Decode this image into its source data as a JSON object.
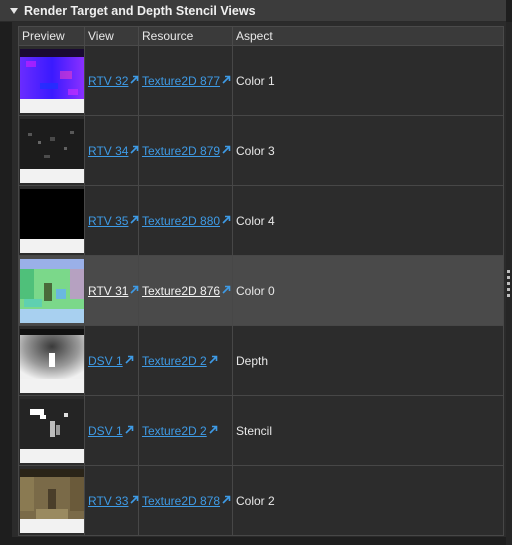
{
  "header": {
    "title": "Render Target and Depth Stencil Views"
  },
  "columns": [
    "Preview",
    "View",
    "Resource",
    "Aspect"
  ],
  "rows": [
    {
      "view": "RTV 32",
      "resource": "Texture2D 877",
      "aspect": "Color 1",
      "selected": false,
      "preview": "blue-purple-noise"
    },
    {
      "view": "RTV 34",
      "resource": "Texture2D 879",
      "aspect": "Color 3",
      "selected": false,
      "preview": "dark-gray-noise"
    },
    {
      "view": "RTV 35",
      "resource": "Texture2D 880",
      "aspect": "Color 4",
      "selected": false,
      "preview": "black"
    },
    {
      "view": "RTV 31",
      "resource": "Texture2D 876",
      "aspect": "Color 0",
      "selected": true,
      "preview": "green-normals"
    },
    {
      "view": "DSV 1",
      "resource": "Texture2D 2",
      "aspect": "Depth",
      "selected": false,
      "preview": "depth-gradient"
    },
    {
      "view": "DSV 1",
      "resource": "Texture2D 2",
      "aspect": "Stencil",
      "selected": false,
      "preview": "stencil-mask"
    },
    {
      "view": "RTV 33",
      "resource": "Texture2D 878",
      "aspect": "Color 2",
      "selected": false,
      "preview": "albedo-corridor"
    }
  ],
  "icons": {
    "collapse": "collapse-triangle-icon",
    "link": "external-link-arrow-icon"
  },
  "colors": {
    "link": "#3e9be6",
    "selected_row": "#4a4a4a",
    "header_bg": "#3c3c3c"
  }
}
